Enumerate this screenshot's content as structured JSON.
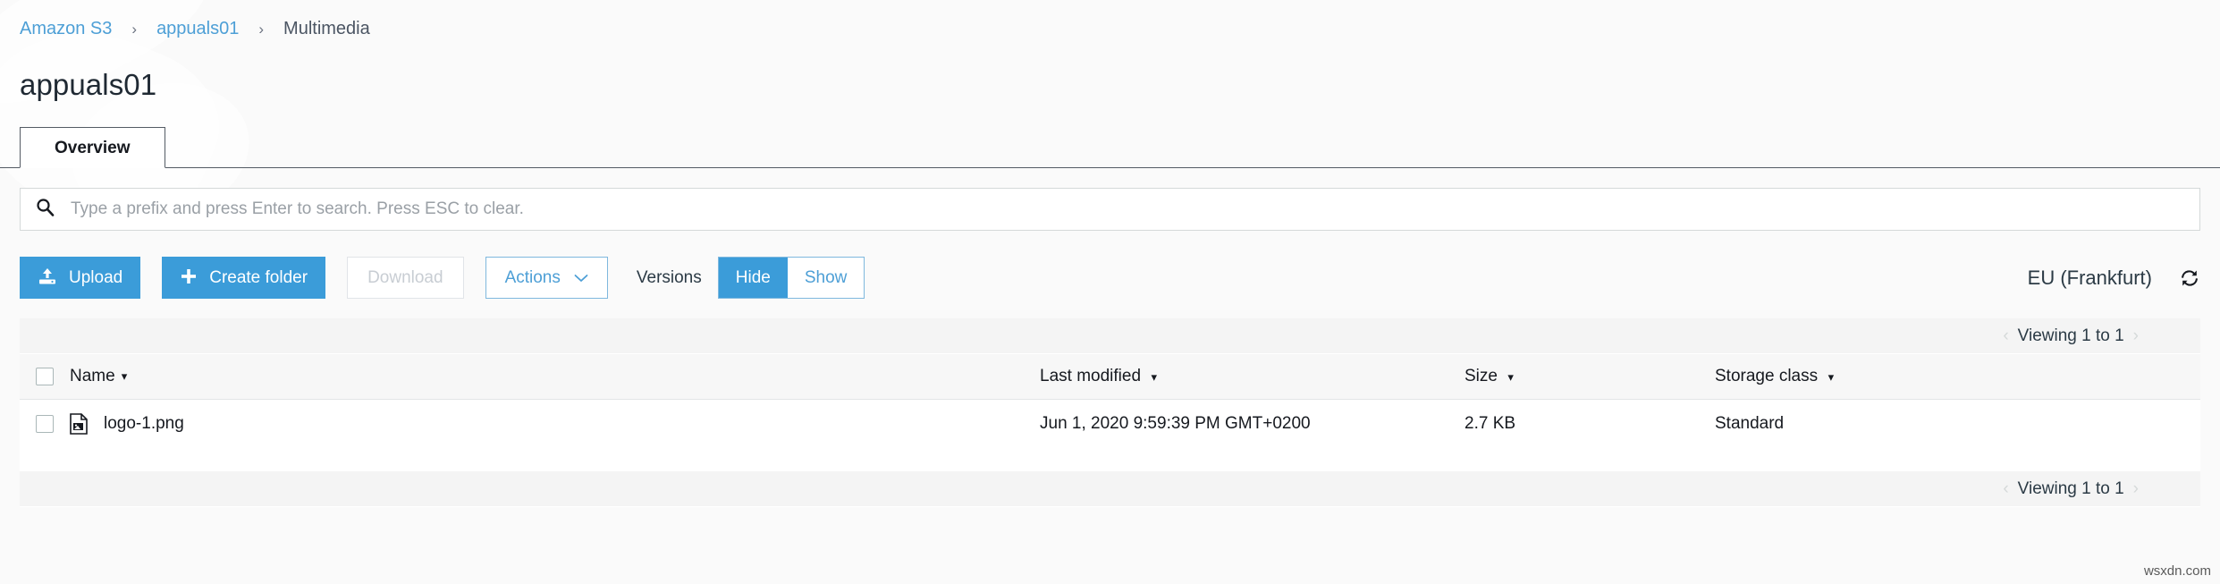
{
  "breadcrumb": {
    "items": [
      {
        "label": "Amazon S3",
        "link": true
      },
      {
        "label": "appuals01",
        "link": true
      },
      {
        "label": "Multimedia",
        "link": false
      }
    ],
    "separator": "›"
  },
  "page_title": "appuals01",
  "tabs": [
    {
      "label": "Overview",
      "active": true
    }
  ],
  "search": {
    "placeholder": "Type a prefix and press Enter to search. Press ESC to clear.",
    "value": "",
    "icon": "search-icon"
  },
  "toolbar": {
    "upload_label": "Upload",
    "upload_icon": "upload-icon",
    "create_folder_label": "Create folder",
    "create_folder_icon": "plus-icon",
    "download_label": "Download",
    "actions_label": "Actions",
    "actions_chevron": "chevron-down-icon",
    "versions_label": "Versions",
    "versions_hide_label": "Hide",
    "versions_show_label": "Show",
    "versions_selected": "Hide",
    "region_label": "EU (Frankfurt)",
    "refresh_icon": "refresh-icon"
  },
  "pagination": {
    "text": "Viewing 1 to 1",
    "prev_icon": "‹",
    "next_icon": "›"
  },
  "table": {
    "columns": [
      {
        "label": "Name",
        "sortable": true
      },
      {
        "label": "Last modified",
        "sortable": true
      },
      {
        "label": "Size",
        "sortable": true
      },
      {
        "label": "Storage class",
        "sortable": true
      }
    ],
    "sort_caret": "▾",
    "rows": [
      {
        "name": "logo-1.png",
        "icon": "image-file-icon",
        "last_modified": "Jun 1, 2020 9:59:39 PM GMT+0200",
        "size": "2.7 KB",
        "storage_class": "Standard"
      }
    ]
  },
  "colors": {
    "accent_blue": "#3b9cd9",
    "link_blue": "#4d9fd6",
    "page_background": "#fafafa",
    "panel_background": "#ffffff"
  },
  "watermark": "wsxdn.com"
}
